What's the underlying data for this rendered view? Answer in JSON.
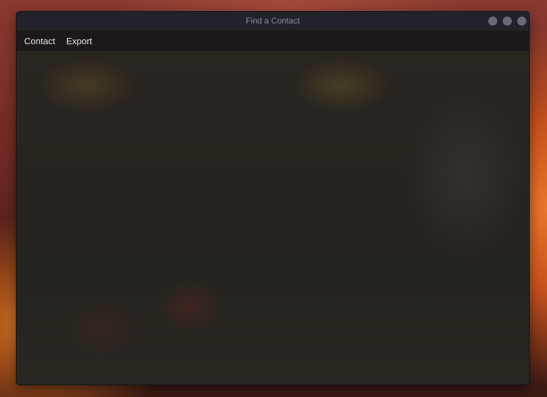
{
  "window": {
    "title": "Find a Contact"
  },
  "menu": {
    "items": [
      {
        "label": "Contact"
      },
      {
        "label": "Export"
      }
    ]
  },
  "colors": {
    "titlebar": "#22232a",
    "menubar": "#1e1918",
    "window_control": "#6a6b71",
    "wallpaper_accent": "#e8772a"
  }
}
